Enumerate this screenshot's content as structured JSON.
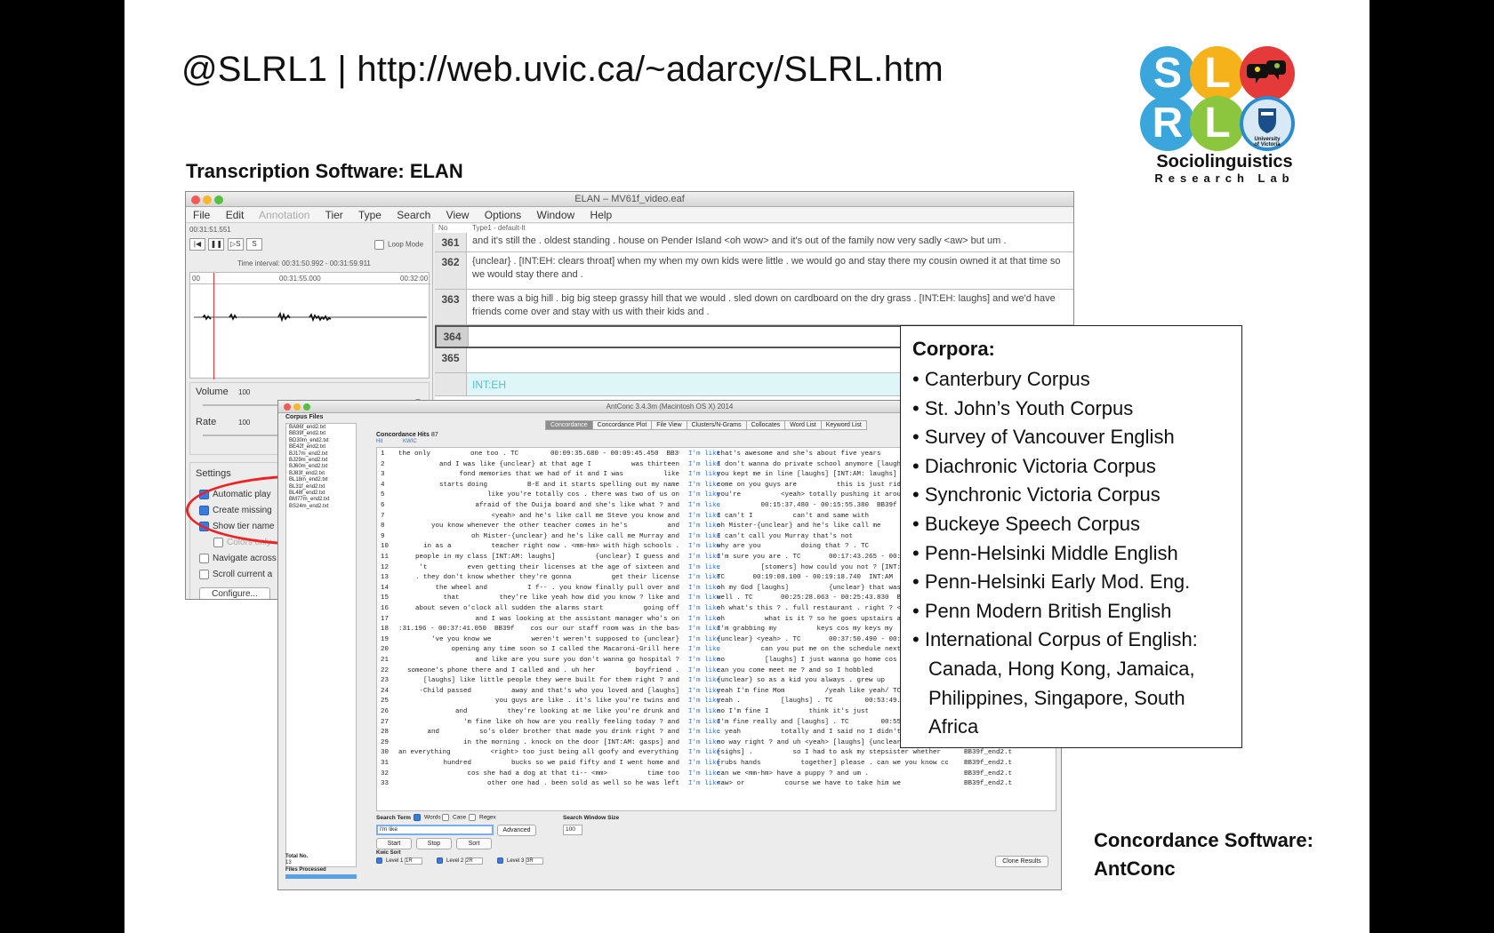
{
  "slide": {
    "title": "@SLRL1 | http://web.uvic.ca/~adarcy/SLRL.htm",
    "elan_caption": "Transcription Software: ELAN",
    "concordance_caption": "Concordance Software: AntConc"
  },
  "logo": {
    "letters": [
      "S",
      "L",
      "R",
      "L"
    ],
    "name": "Sociolinguistics",
    "subtitle": "Research Lab",
    "seal_text": "University of Victoria",
    "colors": {
      "s": "#3aa6dc",
      "l1": "#f5b21b",
      "bubbles": "#e43a3a",
      "r": "#3aa6dc",
      "l2": "#8cc63f",
      "seal": "#2a8ccf"
    }
  },
  "elan": {
    "window_title": "ELAN – MV61f_video.eaf",
    "menus": [
      "File",
      "Edit",
      "Annotation",
      "Tier",
      "Type",
      "Search",
      "View",
      "Options",
      "Window",
      "Help"
    ],
    "time_code": "00:31:51.551",
    "loop_mode": "Loop Mode",
    "time_interval": "Time interval: 00:31:50.992 - 00:31:59.911",
    "ruler_start": "00",
    "ruler_mid": "00:31:55.000",
    "ruler_end": "00:32:00",
    "volume_label": "Volume",
    "volume_value": "100",
    "rate_label": "Rate",
    "rate_value": "100",
    "settings_label": "Settings",
    "settings": [
      {
        "label": "Automatic play",
        "on": true
      },
      {
        "label": "Create missing",
        "on": true
      },
      {
        "label": "Show tier name",
        "on": true
      },
      {
        "label": "Colors only",
        "on": false
      },
      {
        "label": "Navigate across",
        "on": false
      },
      {
        "label": "Scroll current a",
        "on": false
      }
    ],
    "configure_button": "Configure...",
    "table_header_no": "No",
    "table_header_type": "Type1 - default-lt",
    "rows": [
      {
        "no": "361",
        "text": "and it's still the . oldest standing . house on Pender Island <oh wow> and it's out of the family now very sadly <aw> but um ."
      },
      {
        "no": "362",
        "text": "{unclear} . [INT:EH: clears throat] when my when my own kids were little . we would go and stay there my cousin owned it at that time so we would stay there and ."
      },
      {
        "no": "363",
        "text": "there was a big hill . big big steep grassy hill that we would . sled down on cardboard on the dry grass . [INT:EH: laughs] and we'd have friends come over and stay with us with their kids and ."
      },
      {
        "no": "364",
        "text": ""
      },
      {
        "no": "365",
        "text": ""
      }
    ],
    "tier_label": "INT:EH"
  },
  "antconc": {
    "window_title": "AntConc 3.4.3m (Macintosh OS X) 2014",
    "corpus_files_label": "Corpus Files",
    "files": [
      "BA86f_end2.txt",
      "BB39f_end2.txt",
      "BD30m_end2.txt",
      "BE42f_end2.txt",
      "BJ17m_end2.txt",
      "BJ29m_end2.txt",
      "BJ60m_end2.txt",
      "BJ83f_end2.txt",
      "BL18m_end2.txt",
      "BL31f_end2.txt",
      "BL48f_end2.txt",
      "BM77m_end2.txt",
      "BS24m_end2.txt"
    ],
    "tabs": [
      "Concordance",
      "Concordance Plot",
      "File View",
      "Clusters/N-Grams",
      "Collocates",
      "Word List",
      "Keyword List"
    ],
    "selected_tab": "Concordance",
    "hits_label": "Concordance Hits",
    "hits_value": "87",
    "col_hit": "Hit",
    "col_kwic": "KWIC",
    "search_term_label": "Search Term",
    "words_label": "Words",
    "case_label": "Case",
    "regex_label": "Regex",
    "search_value": "I'm like",
    "advanced_button": "Advanced",
    "start_button": "Start",
    "stop_button": "Stop",
    "sort_button": "Sort",
    "window_size_label": "Search Window Size",
    "window_size_value": "100",
    "kwic_sort_label": "Kwic Sort",
    "levels": [
      {
        "label": "Level 1",
        "value": "1R"
      },
      {
        "label": "Level 2",
        "value": "2R"
      },
      {
        "label": "Level 3",
        "value": "3R"
      }
    ],
    "clone_button": "Clone Results",
    "total_no_label": "Total No.",
    "total_no_value": "13",
    "files_processed_label": "Files Processed",
    "lines": [
      {
        "n": "1",
        "l": "the only          one too . TC        00:09:35.680 - 00:09:45.450  BB39f",
        "h": "I'm like",
        "r": "that's awesome and she's about five years",
        "f": ""
      },
      {
        "n": "2",
        "l": "and I was like {unclear} at that age I          was thirteen",
        "h": "I'm like",
        "r": "I don't wanna do private school anymore [laughs]",
        "f": ""
      },
      {
        "n": "3",
        "l": "fond memories that we had of it and I was          like",
        "h": "I'm like",
        "r": "you kept me in line [laughs] [INT:AM: laughs]",
        "f": ""
      },
      {
        "n": "4",
        "l": "starts doing          B-E and it starts spelling out my name",
        "h": "I'm like",
        "r": "come on you guys are          this is just ridiculous",
        "f": ""
      },
      {
        "n": "5",
        "l": "like you're totally cos . there was two of us on",
        "h": "I'm like",
        "r": "you're          <yeah> totally pushing it around and . TC",
        "f": ""
      },
      {
        "n": "6",
        "l": "afraid of the Ouija board and she's like what ? and",
        "h": "I'm like",
        "r": ".          00:15:37.480 - 00:15:55.380  BB39f    well just",
        "f": ""
      },
      {
        "n": "7",
        "l": "<yeah> and he's like call me Steve you know and",
        "h": "I'm like",
        "r": "I can't I          can't and same with",
        "f": ""
      },
      {
        "n": "8",
        "l": "you know whenever the other teacher comes in he's          and",
        "h": "I'm like",
        "r": "oh Mister-{unclear} and he's like call me",
        "f": ""
      },
      {
        "n": "9",
        "l": "oh Mister-{unclear} and he's like call me Murray and",
        "h": "I'm like",
        "r": "I can't call you Murray that's not",
        "f": ""
      },
      {
        "n": "10",
        "l": "in as a          teacher right now . <mm-hm> with high schools .",
        "h": "I'm like",
        "r": "why are you          doing that ? . TC        00:17:32.130",
        "f": ""
      },
      {
        "n": "11",
        "l": "people in my class [INT:AM: laughs]          {unclear} I guess and",
        "h": "I'm like",
        "r": "I'm sure you are . TC       00:17:43.265 - 00:17:52.730",
        "f": ""
      },
      {
        "n": "12",
        "l": "'t          even getting their licenses at the age of sixteen and",
        "h": "I'm like",
        "r": ".          [stomers] how could you not ? [INT:AM: laughs]",
        "f": ""
      },
      {
        "n": "13",
        "l": ". they don't know whether they're gonna          get their license",
        "h": "I'm like",
        "r": "TC       00:19:08.100 - 00:19:18.740  INT:AM   hm . wi--",
        "f": ""
      },
      {
        "n": "14",
        "l": "the wheel and          I f-- . you know finally pull over and",
        "h": "I'm like",
        "r": "oh my God [laughs]          {unclear} that was so freaking",
        "f": ""
      },
      {
        "n": "15",
        "l": "that          they're like yeah how did you know ? like and",
        "h": "I'm like",
        "r": "well . TC       00:25:28.063 - 00:25:43.830  BB39f    I've",
        "f": ""
      },
      {
        "n": "16",
        "l": "about seven o'clock all sudden the alarms start          going off",
        "h": "I'm like",
        "r": "oh what's this ? . full restaurant . right ? <oh>",
        "f": ""
      },
      {
        "n": "17",
        "l": "and I was looking at the assistant manager who's on",
        "h": "I'm like",
        "r": "oh          what is it ? so he goes upstairs and",
        "f": ""
      },
      {
        "n": "18",
        "l": ":31.196 - 00:37:41.050  BB39f    cos our our staff room was in the basement",
        "h": "I'm like",
        "r": "I'm grabbing my          keys cos my keys my",
        "f": ""
      },
      {
        "n": "19",
        "l": "'ve you know we          weren't weren't supposed to {unclear}",
        "h": "I'm like",
        "r": "{unclear} <yeah> . TC       00:37:50.490 - 00:37:58.780",
        "f": ""
      },
      {
        "n": "20",
        "l": "opening any time soon so I called the Macaroni-Grill here",
        "h": "I'm like",
        "r": ".          can you put me on the schedule next week ? [",
        "f": ""
      },
      {
        "n": "21",
        "l": "and like are you sure you don't wanna go hospital ?",
        "h": "I'm like",
        "r": "no          [laughs] I just wanna go home cos it",
        "f": ""
      },
      {
        "n": "22",
        "l": "someone's phone there and I called and . uh her          boyfriend .",
        "h": "I'm like",
        "r": "can you come meet me ? and so I hobbled",
        "f": ""
      },
      {
        "n": "23",
        "l": "[laughs] like little people they were built for them right ? and",
        "h": "I'm like",
        "r": "{unclear} so as a kid you always . grew up",
        "f": ""
      },
      {
        "n": "24",
        "l": "-Child passed          away and that's who you loved and [laughs]",
        "h": "I'm like",
        "r": "yeah I'm fine Mom          /yeah like yeah/ TC",
        "f": ""
      },
      {
        "n": "25",
        "l": "you guys are like . it's like you're twins and",
        "h": "I'm like",
        "r": "yeah .          [laughs] . TC        00:53:49.020 - 00:53",
        "f": ""
      },
      {
        "n": "26",
        "l": "and          they're looking at me like you're drunk and",
        "h": "I'm like",
        "r": "no I'm fine I          think it's just",
        "f": ""
      },
      {
        "n": "27",
        "l": "'m fine like oh how are you really feeling today ? and",
        "h": "I'm like",
        "r": "I'm fine really and [laughs] . TC        00:55:40",
        "f": ""
      },
      {
        "n": "28",
        "l": "and          so's older brother that made you drink right ? and",
        "h": "I'm like",
        "r": ". yeah          totally and I said no I didn't",
        "f": ""
      },
      {
        "n": "29",
        "l": "in the morning . knock on the door [INT:AM: gasps] and",
        "h": "I'm like",
        "r": "no way right ? and uh <yeah> [laughs] {unclear}",
        "f": ""
      },
      {
        "n": "30",
        "l": "an everything          <right> too just being all goofy and everything and",
        "h": "I'm like",
        "r": "[sighs] .          so I had to ask my stepsister whether",
        "f": "BB39f_end2.t"
      },
      {
        "n": "31",
        "l": "hundred          bucks so we paid fifty and I went home and",
        "h": "I'm like",
        "r": "[rubs hands          together] please . can we you know cos",
        "f": "BB39f_end2.t"
      },
      {
        "n": "32",
        "l": "cos she had a dog at that ti-- <mm>          time too",
        "h": "I'm like",
        "r": "can we <mm-hm> have a puppy ? and um .",
        "f": "BB39f_end2.t"
      },
      {
        "n": "33",
        "l": "other one had . been sold as well so he was left",
        "h": "I'm like",
        "r": "<aw> or          course we have to take him we",
        "f": "BB39f_end2.t"
      }
    ]
  },
  "corpora": {
    "title": "Corpora:",
    "items": [
      "Canterbury Corpus",
      "St. John’s Youth Corpus",
      "Survey of Vancouver English",
      "Diachronic Victoria Corpus",
      "Synchronic Victoria Corpus",
      "Buckeye Speech Corpus",
      "Penn-Helsinki Middle English",
      "Penn-Helsinki Early Mod. Eng.",
      "Penn Modern British English",
      "International Corpus of English: Canada, Hong Kong, Jamaica, Philippines, Singapore, South Africa"
    ]
  }
}
